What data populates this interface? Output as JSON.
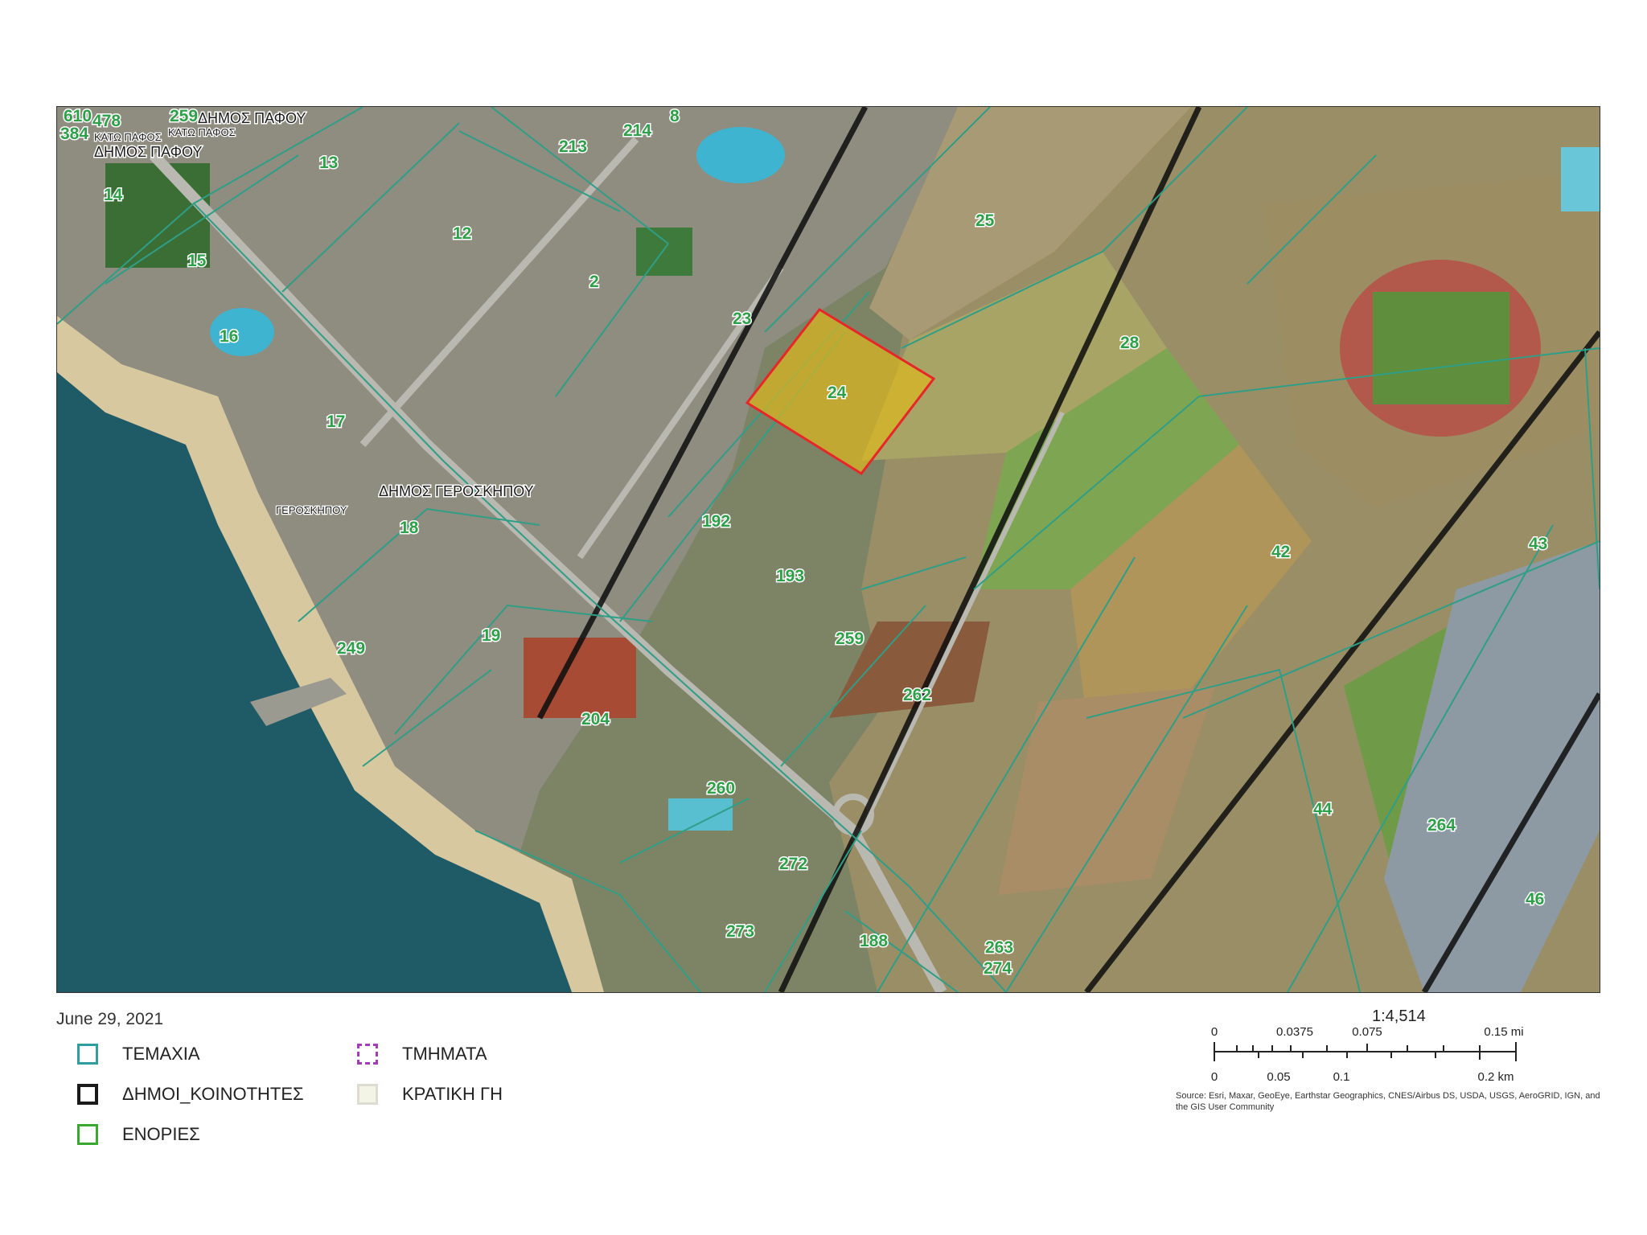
{
  "map": {
    "parcel_numbers": [
      "610",
      "478",
      "259",
      "384",
      "13",
      "14",
      "15",
      "16",
      "17",
      "18",
      "19",
      "213",
      "214",
      "8",
      "12",
      "2",
      "23",
      "25",
      "24",
      "28",
      "192",
      "193",
      "259",
      "262",
      "204",
      "249",
      "260",
      "272",
      "273",
      "188",
      "263",
      "274",
      "42",
      "43",
      "44",
      "264",
      "46"
    ],
    "place_names": {
      "dimos_pafou_top": "ΔΗΜΟΣ ΠΑΦΟΥ",
      "dimos_pafou_left": "ΔΗΜΟΣ ΠΑΦΟΥ",
      "kato_pafos_1": "ΚΑΤΩ ΠΑΦΟΣ",
      "kato_pafos_2": "ΚΑΤΩ ΠΑΦΟΣ",
      "dimos_geroskipou": "ΔΗΜΟΣ ΓΕΡΟΣΚΗΠΟΥ",
      "geroskipou": "ΓΕΡΟΣΚΗΠΟΥ"
    },
    "highlighted_parcel": "24",
    "colors": {
      "parcel_outline": "#2f9e86",
      "highlight_fill": "#d9b620",
      "highlight_stroke": "#e8262a",
      "label": "#2ea04a",
      "municipal_boundary": "#111111",
      "sea": "#1f5b66"
    }
  },
  "date": "June 29, 2021",
  "legend": {
    "items": [
      {
        "label": "ΤΕΜΑΧΙΑ",
        "swatch": "parcels",
        "border": "#2f9e9e",
        "fill": "#ffffff"
      },
      {
        "label": "ΔΗΜΟΙ_ΚΟΙΝΟΤΗΤΕΣ",
        "swatch": "municipalities",
        "border": "#1a1a1a",
        "fill": "#ffffff"
      },
      {
        "label": "ΕΝΟΡΙΕΣ",
        "swatch": "parishes",
        "border": "#3aa830",
        "fill": "#ffffff"
      },
      {
        "label": "ΤΜΗΜΑΤΑ",
        "swatch": "sections",
        "border": "#a23db8",
        "fill": "#ffffff"
      },
      {
        "label": "ΚΡΑΤΙΚΗ ΓΗ",
        "swatch": "state-land",
        "border": "#dcdcd0",
        "fill": "#f4f4e6"
      }
    ]
  },
  "scale": {
    "ratio": "1:4,514",
    "mi_ticks": [
      "0",
      "0.0375",
      "0.075",
      "0.15 mi"
    ],
    "km_ticks": [
      "0",
      "0.05",
      "0.1",
      "0.2 km"
    ]
  },
  "attribution": "Source: Esri, Maxar, GeoEye, Earthstar Geographics, CNES/Airbus DS, USDA, USGS, AeroGRID, IGN, and the GIS User Community"
}
